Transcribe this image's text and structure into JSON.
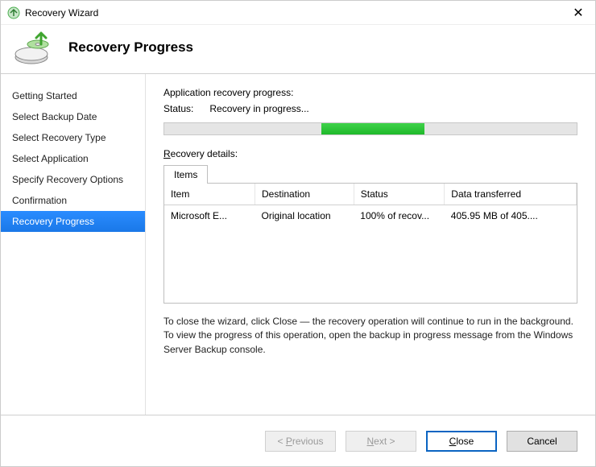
{
  "window": {
    "title": "Recovery Wizard",
    "close_glyph": "✕"
  },
  "header": {
    "title": "Recovery Progress"
  },
  "sidebar": {
    "items": [
      {
        "label": "Getting Started"
      },
      {
        "label": "Select Backup Date"
      },
      {
        "label": "Select Recovery Type"
      },
      {
        "label": "Select Application"
      },
      {
        "label": "Specify Recovery Options"
      },
      {
        "label": "Confirmation"
      },
      {
        "label": "Recovery Progress"
      }
    ],
    "active_index": 6
  },
  "main": {
    "progress_label": "Application recovery progress:",
    "status_label": "Status:",
    "status_value": "Recovery in progress...",
    "progress_percent": 46,
    "progress_indeterminate": true,
    "details_access_prefix": "R",
    "details_label_rest": "ecovery details:",
    "tab_label": "Items",
    "columns": {
      "item": "Item",
      "destination": "Destination",
      "status": "Status",
      "data": "Data transferred"
    },
    "rows": [
      {
        "item": "Microsoft E...",
        "destination": "Original location",
        "status": "100% of recov...",
        "data": "405.95 MB of 405...."
      }
    ],
    "help_text": "To close the wizard, click Close — the recovery operation will continue to run in the background. To view the progress of this operation, open the backup in progress message from the Windows Server Backup console."
  },
  "footer": {
    "previous_access": "P",
    "previous_rest": "revious",
    "previous_prefix": "< ",
    "next_access": "N",
    "next_rest": "ext >",
    "close_access": "C",
    "close_rest": "lose",
    "cancel": "Cancel"
  }
}
